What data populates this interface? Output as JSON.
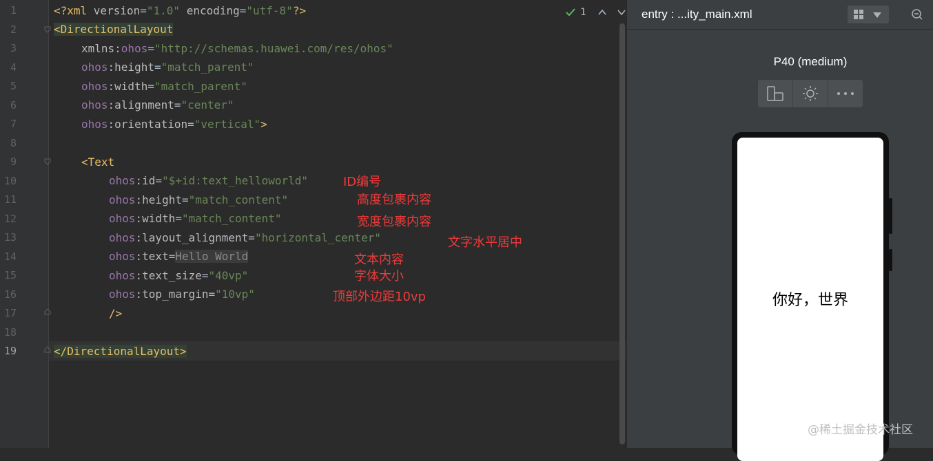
{
  "editor": {
    "line_numbers": [
      "1",
      "2",
      "3",
      "4",
      "5",
      "6",
      "7",
      "8",
      "9",
      "10",
      "11",
      "12",
      "13",
      "14",
      "15",
      "16",
      "17",
      "18",
      "19"
    ],
    "lines": {
      "l1": {
        "a": "<?xml ",
        "b": "version",
        "c": "=",
        "d": "\"1.0\"",
        "e": " ",
        "f": "encoding",
        "g": "=",
        "h": "\"utf-8\"",
        "i": "?>"
      },
      "l2": {
        "a": "<DirectionalLayout"
      },
      "l3": {
        "ns": "xmlns:",
        "ns2": "ohos",
        "eq": "=",
        "val": "\"http://schemas.huawei.com/res/ohos\""
      },
      "l4": {
        "ns": "ohos",
        "attr": ":height",
        "eq": "=",
        "val": "\"match_parent\""
      },
      "l5": {
        "ns": "ohos",
        "attr": ":width",
        "eq": "=",
        "val": "\"match_parent\""
      },
      "l6": {
        "ns": "ohos",
        "attr": ":alignment",
        "eq": "=",
        "val": "\"center\""
      },
      "l7": {
        "ns": "ohos",
        "attr": ":orientation",
        "eq": "=",
        "val": "\"vertical\"",
        "end": ">"
      },
      "l9": {
        "a": "<Text"
      },
      "l10": {
        "ns": "ohos",
        "attr": ":id",
        "eq": "=",
        "val": "\"$+id:text_helloworld\""
      },
      "l11": {
        "ns": "ohos",
        "attr": ":height",
        "eq": "=",
        "val": "\"match_content\""
      },
      "l12": {
        "ns": "ohos",
        "attr": ":width",
        "eq": "=",
        "val": "\"match_content\""
      },
      "l13": {
        "ns": "ohos",
        "attr": ":layout_alignment",
        "eq": "=",
        "val": "\"horizontal_center\""
      },
      "l14": {
        "ns": "ohos",
        "attr": ":text",
        "eq": "=",
        "val": "Hello World"
      },
      "l15": {
        "ns": "ohos",
        "attr": ":text_size",
        "eq": "=",
        "val": "\"40vp\""
      },
      "l16": {
        "ns": "ohos",
        "attr": ":top_margin",
        "eq": "=",
        "val": "\"10vp\""
      },
      "l17": {
        "a": "/>"
      },
      "l19": {
        "a": "</DirectionalLayout>"
      }
    },
    "inspection_count": "1",
    "annotations": [
      "ID编号",
      "高度包裹内容",
      "宽度包裹内容",
      "文字水平居中",
      "文本内容",
      "字体大小",
      "顶部外边距10vp"
    ]
  },
  "preview": {
    "title": "entry : ...ity_main.xml",
    "device": "P40 (medium)",
    "screen_text": "你好，世界"
  },
  "watermark": "@稀土掘金技术社区"
}
